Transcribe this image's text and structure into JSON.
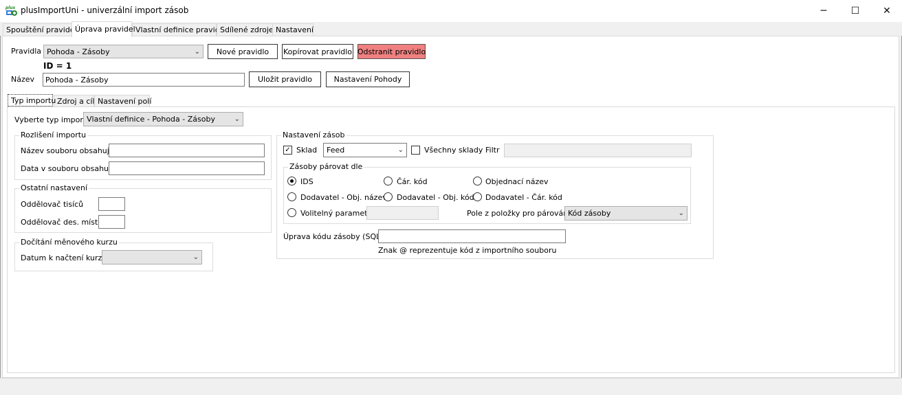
{
  "window": {
    "title": "plusImportUni - univerzální import zásob",
    "logo_text": "plus",
    "minimize_glyph": "─",
    "maximize_glyph": "☐",
    "close_glyph": "✕"
  },
  "main_tabs": [
    {
      "label": "Spouštění pravidel"
    },
    {
      "label": "Úprava pravidel"
    },
    {
      "label": "Vlastní definice pravidel"
    },
    {
      "label": "Sdílené zdroje"
    },
    {
      "label": "Nastavení"
    }
  ],
  "rules": {
    "label": "Pravidla",
    "selected": "Pohoda - Zásoby",
    "new_button": "Nové pravidlo",
    "copy_button": "Kopírovat pravidlo",
    "delete_button": "Odstranit pravidlo",
    "delete_color": "#f08080",
    "id_text": "ID = 1",
    "name_label": "Název",
    "name_value": "Pohoda - Zásoby",
    "save_button": "Uložit pravidlo",
    "pohoda_settings_button": "Nastavení Pohody"
  },
  "sub_tabs": [
    {
      "label": "Typ importu"
    },
    {
      "label": "Zdroj a cíl"
    },
    {
      "label": "Nastavení polí"
    }
  ],
  "import_type": {
    "label": "Vyberte typ importu",
    "selected": "Vlastní definice - Pohoda - Zásoby"
  },
  "resolution": {
    "legend": "Rozlišení importu",
    "filename_label": "Název souboru obsahuje",
    "filename_value": "",
    "data_label": "Data v souboru obsahují",
    "data_value": ""
  },
  "other": {
    "legend": "Ostatní nastavení",
    "thousands_label": "Oddělovač tisíců",
    "thousands_value": "",
    "decimal_label": "Oddělovač des. míst",
    "decimal_value": ""
  },
  "currency": {
    "legend": "Dočítání měnového kurzu",
    "date_label": "Datum k načtení kurzu",
    "date_value": ""
  },
  "stock": {
    "legend": "Nastavení zásob",
    "warehouse_label": "Sklad",
    "warehouse_checked": true,
    "warehouse_value": "Feed",
    "all_warehouses_label": "Všechny sklady",
    "all_warehouses_checked": false,
    "filter_label": "Filtr",
    "filter_value": "",
    "pairing": {
      "legend": "Zásoby párovat dle",
      "options": [
        {
          "label": "IDS",
          "checked": true
        },
        {
          "label": "Čár. kód",
          "checked": false
        },
        {
          "label": "Objednací název",
          "checked": false
        },
        {
          "label": "Dodavatel - Obj. název",
          "checked": false
        },
        {
          "label": "Dodavatel - Obj. kód",
          "checked": false
        },
        {
          "label": "Dodavatel - Čár. kód",
          "checked": false
        },
        {
          "label": "Volitelný parametr",
          "checked": false
        }
      ],
      "optional_param_value": "",
      "field_label": "Pole z položky pro párování",
      "field_value": "Kód zásoby"
    },
    "sql_label": "Úprava kódu zásoby (SQL)",
    "sql_value": "",
    "sql_hint": "Znak @ reprezentuje kód z importního souboru"
  },
  "icons": {
    "dropdown": "⌄",
    "check": "✓"
  }
}
